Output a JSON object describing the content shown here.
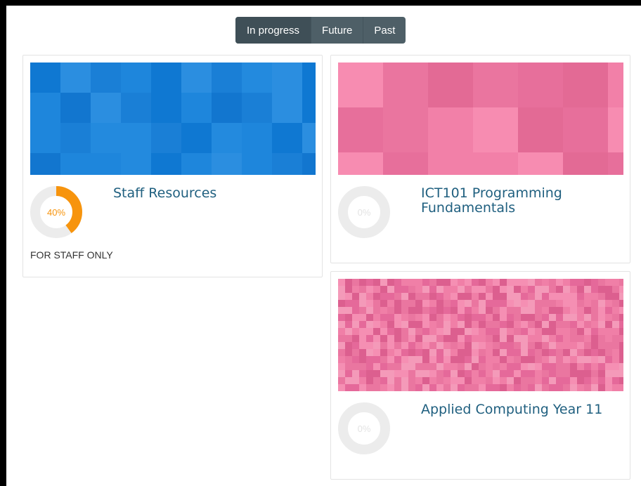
{
  "tabs": [
    {
      "label": "In progress",
      "active": true
    },
    {
      "label": "Future",
      "active": false
    },
    {
      "label": "Past",
      "active": false
    }
  ],
  "courses": [
    {
      "title": "Staff Resources",
      "progress_label": "40%",
      "progress": 0.4,
      "category": "FOR STAFF ONLY",
      "banner_palette": [
        "#1a7fd6",
        "#1e86dc",
        "#0f78d2",
        "#2b8ee0",
        "#1276cf",
        "#238ade"
      ],
      "progress_color": "#f7940d"
    },
    {
      "title_lines": [
        "ICT101 Programming",
        "Fundamentals"
      ],
      "progress_label": "0%",
      "progress": 0.0,
      "banner_palette": [
        "#e76f9b",
        "#f280a8",
        "#ea759f",
        "#f78cb1",
        "#e36a95"
      ]
    },
    {
      "title": "Applied Computing Year 11",
      "progress_label": "0%",
      "progress": 0.0,
      "banner_palette": [
        "#f07fa7",
        "#e5699a",
        "#f58fb3",
        "#ea76a0",
        "#f49ab9",
        "#dc5f8f"
      ]
    }
  ],
  "colors": {
    "title": "#1f5f7f",
    "ring_track": "#ececec",
    "ring_empty_text": "#e3e3e3"
  }
}
